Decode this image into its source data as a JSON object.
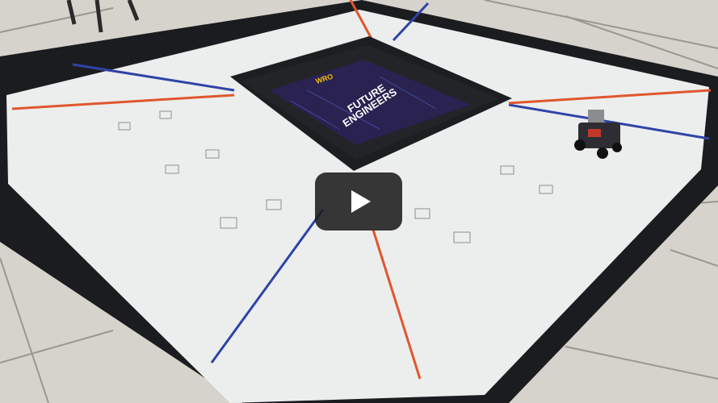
{
  "video": {
    "title": "WRO Future Engineers robot run on the field",
    "play_button": "play-icon"
  },
  "mat": {
    "logo_text": "WRO",
    "banner_line1": "FUTURE",
    "banner_line2": "ENGINEERS"
  },
  "colors": {
    "floor": "#d9d6cf",
    "mat": "#eef0ef",
    "wall": "#1b1c1f",
    "blue_line": "#2f43a8",
    "orange_line": "#e0562e",
    "banner": "#2a2250",
    "play_bg": "#1c1c1c"
  }
}
